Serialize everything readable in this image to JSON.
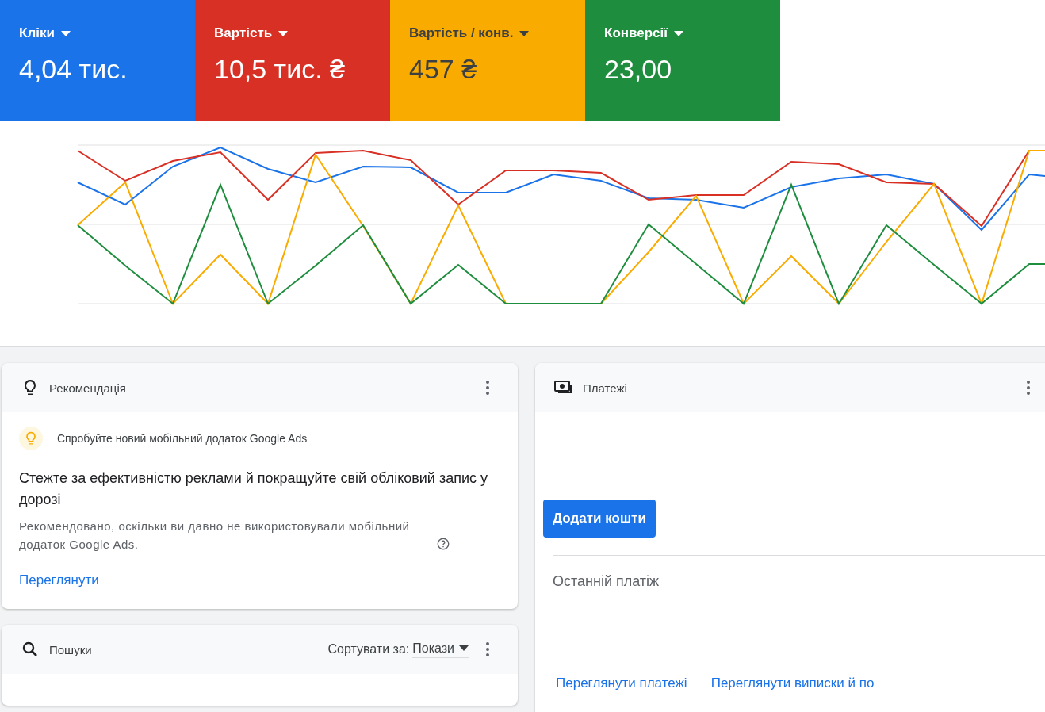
{
  "metrics": [
    {
      "label": "Кліки",
      "value": "4,04 тис.",
      "color": "#1a73e8"
    },
    {
      "label": "Вартість",
      "value": "10,5 тис. ₴",
      "color": "#d93025"
    },
    {
      "label": "Вартість / конв.",
      "value": "457 ₴",
      "color": "#f9ab00"
    },
    {
      "label": "Конверсії",
      "value": "23,00",
      "color": "#1e8e3e"
    }
  ],
  "recommendation_card": {
    "title": "Рекомендація",
    "tip": "Спробуйте новий мобільний додаток Google Ads",
    "heading": "Стежте за ефективністю реклами й покращуйте свій обліковий запис у дорозі",
    "description": "Рекомендовано, оскільки ви давно не використовували мобільний додаток Google Ads.",
    "link": "Переглянути"
  },
  "payments_card": {
    "title": "Платежі",
    "button": "Додати кошти",
    "last_payment_label": "Останній платіж",
    "links": [
      "Переглянути платежі",
      "Переглянути виписки й по"
    ]
  },
  "searches_card": {
    "title": "Пошуки",
    "sort_label": "Сортувати за:",
    "sort_value": "Покази"
  }
}
